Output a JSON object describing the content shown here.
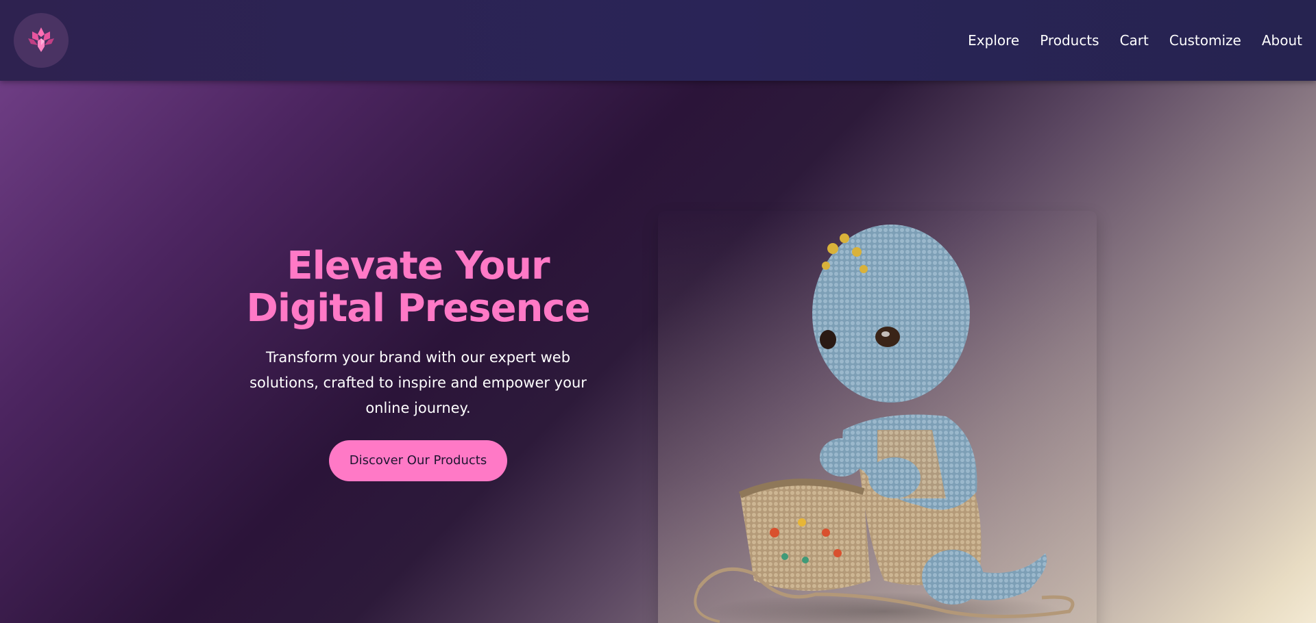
{
  "header": {
    "logo_icon": "crystal-lotus-logo-icon",
    "nav": [
      {
        "label": "Explore"
      },
      {
        "label": "Products"
      },
      {
        "label": "Cart"
      },
      {
        "label": "Customize"
      },
      {
        "label": "About"
      }
    ]
  },
  "hero": {
    "title": "Elevate Your Digital Presence",
    "subtitle": "Transform your brand with our expert web solutions, crafted to inspire and empower your online journey.",
    "cta_label": "Discover Our Products",
    "image_icon": "crochet-doll-image",
    "colors": {
      "accent": "#ff79c6",
      "header_bg": "#2a2457",
      "text": "#ffffff"
    }
  }
}
